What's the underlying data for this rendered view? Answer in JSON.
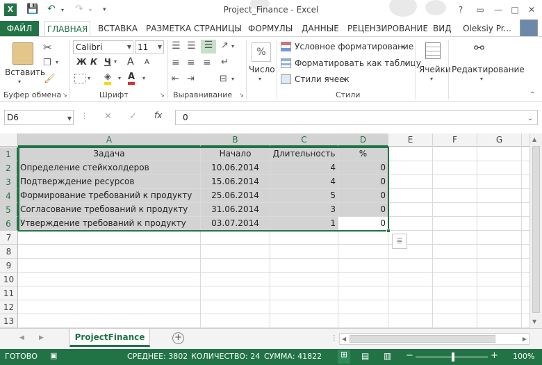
{
  "window": {
    "title": "Project_Finance - Excel",
    "controls": {
      "help": "?",
      "restore": "▭",
      "minimize": "—",
      "maximize": "□",
      "close": "✕"
    }
  },
  "tabs": {
    "file": "ФАЙЛ",
    "home": "ГЛАВНАЯ",
    "insert": "ВСТАВКА",
    "layout": "РАЗМЕТКА СТРАНИЦЫ",
    "formulas": "ФОРМУЛЫ",
    "data": "ДАННЫЕ",
    "review": "РЕЦЕНЗИРОВАНИЕ",
    "view": "ВИД",
    "user": "Oleksiy Pr..."
  },
  "ribbon": {
    "clipboard": {
      "paste": "Вставить",
      "label": "Буфер обмена"
    },
    "font": {
      "name": "Calibri",
      "size": "11",
      "bold": "Ж",
      "italic": "К",
      "underline": "Ч",
      "grow": "A",
      "shrink": "A",
      "label": "Шрифт"
    },
    "alignment": {
      "label": "Выравнивание"
    },
    "number": {
      "percent": "%",
      "label": "Число"
    },
    "styles": {
      "cond": "Условное форматирование",
      "table": "Форматировать как таблицу",
      "cell": "Стили ячеек",
      "label": "Стили"
    },
    "cells": {
      "label": "Ячейки"
    },
    "editing": {
      "label": "Редактирование"
    }
  },
  "formula_bar": {
    "name_box": "D6",
    "value": "0",
    "fx": "fx",
    "cancel": "✕",
    "enter": "✓"
  },
  "grid": {
    "columns": [
      "A",
      "B",
      "C",
      "D",
      "E",
      "F",
      "G"
    ],
    "rows": [
      "1",
      "2",
      "3",
      "4",
      "5",
      "6",
      "7",
      "8",
      "9",
      "10",
      "11",
      "12",
      "13"
    ],
    "header": [
      "Задача",
      "Начало",
      "Длительность",
      "%"
    ],
    "data": [
      [
        "Определение стейкхолдеров",
        "10.06.2014",
        "4",
        "0"
      ],
      [
        "Подтверждение ресурсов",
        "15.06.2014",
        "4",
        "0"
      ],
      [
        "Формирование требований к продукту",
        "25.06.2014",
        "5",
        "0"
      ],
      [
        "Согласование требований к продукту",
        "31.06.2014",
        "3",
        "0"
      ],
      [
        "Утверждение требований к продукту",
        "03.07.2014",
        "1",
        "0"
      ]
    ]
  },
  "sheets": {
    "active": "ProjectFinance",
    "add": "+"
  },
  "status": {
    "ready": "ГОТОВО",
    "average": "СРЕДНЕЕ: 3802",
    "count": "КОЛИЧЕСТВО: 24",
    "sum": "СУММА: 41822",
    "zoom": "100%"
  },
  "colors": {
    "accent": "#217346",
    "selection": "#d3d3d3"
  }
}
